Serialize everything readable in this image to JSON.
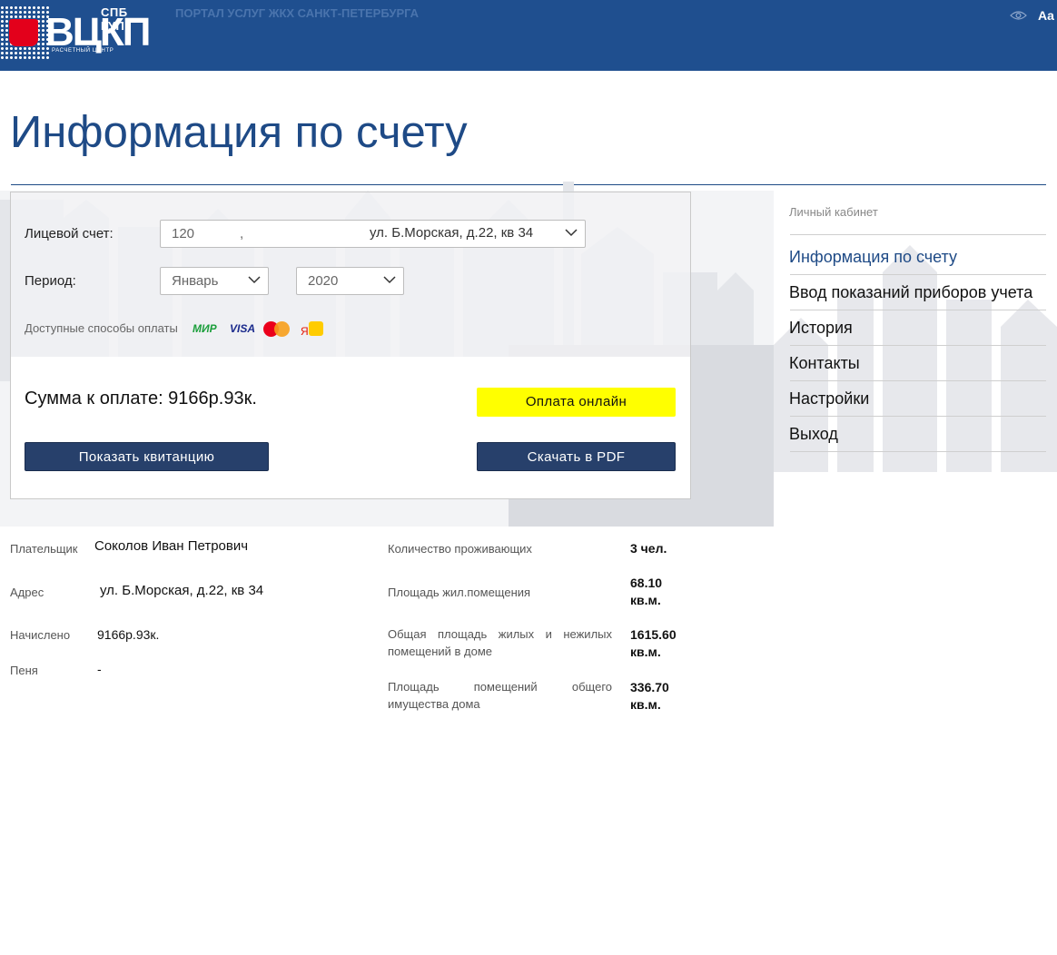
{
  "header": {
    "logo_small": "СПБ ГУП",
    "logo_big": "ВЦКП",
    "logo_sub": "РАСЧЕТНЫЙ ЦЕНТР",
    "portal_title": "ПОРТАЛ УСЛУГ ЖКХ САНКТ-ПЕТЕРБУРГА",
    "font_toggle": "Aa",
    "eye_icon": "eye-icon"
  },
  "page": {
    "title": "Информация по счету"
  },
  "form": {
    "account_label": "Лицевой счет:",
    "account_number": "120",
    "account_separator": ",",
    "account_address": "ул. Б.Морская, д.22, кв 34",
    "period_label": "Период:",
    "month": "Январь",
    "year": "2020",
    "payment_methods_label": "Доступные способы оплаты",
    "payment_logos": [
      "МИР",
      "VISA",
      "MasterCard",
      "Я"
    ],
    "sum_text": "Сумма к оплате: 9166р.93к.",
    "pay_online": "Оплата онлайн",
    "show_receipt": "Показать квитанцию",
    "download_pdf": "Скачать в PDF"
  },
  "details": {
    "payer_label": "Плательщик",
    "payer_value": "Соколов Иван Петрович",
    "address_label": "Адрес",
    "address_value": "ул. Б.Морская, д.22, кв 34",
    "charged_label": "Начислено",
    "charged_value": "9166р.93к.",
    "penalty_label": "Пеня",
    "penalty_value": "-",
    "residents_label": "Количество проживающих",
    "residents_value": "3 чел.",
    "living_area_label": "Площадь жил.помещения",
    "living_area_value": "68.10 кв.м.",
    "total_area_label": "Общая площадь жилых и нежилых помещений в доме",
    "total_area_value": "1615.60 кв.м.",
    "common_area_label": "Площадь помещений общего имущества дома",
    "common_area_value": "336.70 кв.м."
  },
  "sidebar": {
    "heading": "Личный кабинет",
    "items": [
      {
        "label": "Информация по счету"
      },
      {
        "label": "Ввод показаний приборов учета"
      },
      {
        "label": "История"
      },
      {
        "label": "Контакты"
      },
      {
        "label": "Настройки"
      },
      {
        "label": "Выход"
      }
    ]
  },
  "colors": {
    "header_bg": "#1f4f8f",
    "title": "#1e4a86",
    "accent_yellow": "#ffff00",
    "button_dark": "#27406b"
  }
}
